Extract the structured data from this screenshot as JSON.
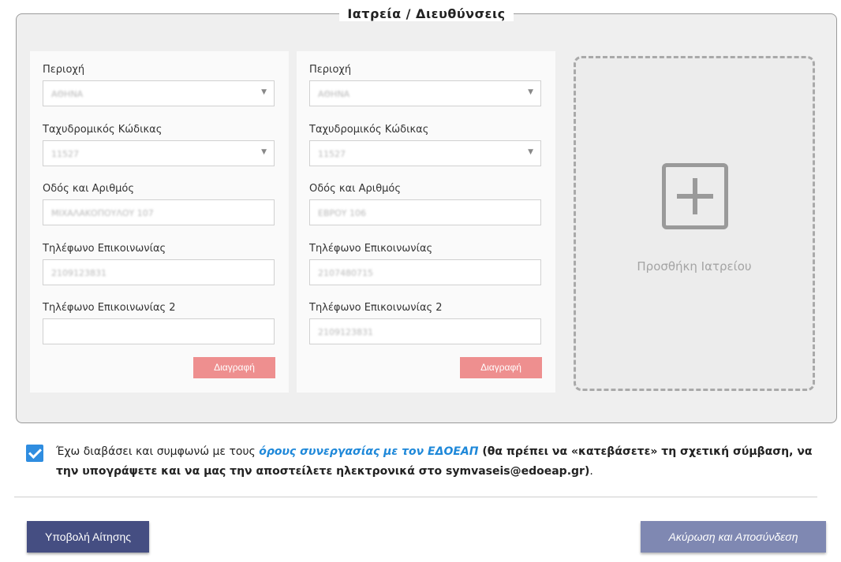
{
  "section": {
    "title": "Ιατρεία / Διευθύνσεις"
  },
  "clinics": [
    {
      "area_label": "Περιοχή",
      "area_value": "ΑΘΗΝΑ",
      "postal_label": "Ταχυδρομικός Κώδικας",
      "postal_value": "11527",
      "street_label": "Οδός και Αριθμός",
      "street_value": "ΜΙΧΑΛΑΚΟΠΟΥΛΟΥ 107",
      "phone_label": "Τηλέφωνο Επικοινωνίας",
      "phone_value": "2109123831",
      "phone2_label": "Τηλέφωνο Επικοινωνίας 2",
      "phone2_value": "",
      "delete_label": "Διαγραφή"
    },
    {
      "area_label": "Περιοχή",
      "area_value": "ΑΘΗΝΑ",
      "postal_label": "Ταχυδρομικός Κώδικας",
      "postal_value": "11527",
      "street_label": "Οδός και Αριθμός",
      "street_value": "ΕΒΡΟΥ 106",
      "phone_label": "Τηλέφωνο Επικοινωνίας",
      "phone_value": "2107480715",
      "phone2_label": "Τηλέφωνο Επικοινωνίας 2",
      "phone2_value": "2109123831",
      "delete_label": "Διαγραφή"
    }
  ],
  "add_clinic": {
    "label": "Προσθήκη Ιατρείου",
    "icon": "plus-square-icon"
  },
  "agreement": {
    "checked": true,
    "text_before": "Έχω διαβάσει και συμφωνώ με τους ",
    "link_text": "όρους συνεργασίας με τον ΕΔΟΕΑΠ",
    "text_bold": " (θα πρέπει να «κατεβάσετε» τη σχετική σύμβαση, να την υπογράψετε και να μας την αποστείλετε ηλεκτρονικά στο symvaseis@edoeap.gr)",
    "text_end": "."
  },
  "actions": {
    "submit_label": "Υποβολή Αίτησης",
    "cancel_label": "Ακύρωση και Αποσύνδεση"
  },
  "colors": {
    "delete_button": "#ee8f8f",
    "submit_button": "#454e82",
    "cancel_button": "#7f88b2",
    "checkbox": "#2f8de0",
    "link": "#1e88d9"
  }
}
